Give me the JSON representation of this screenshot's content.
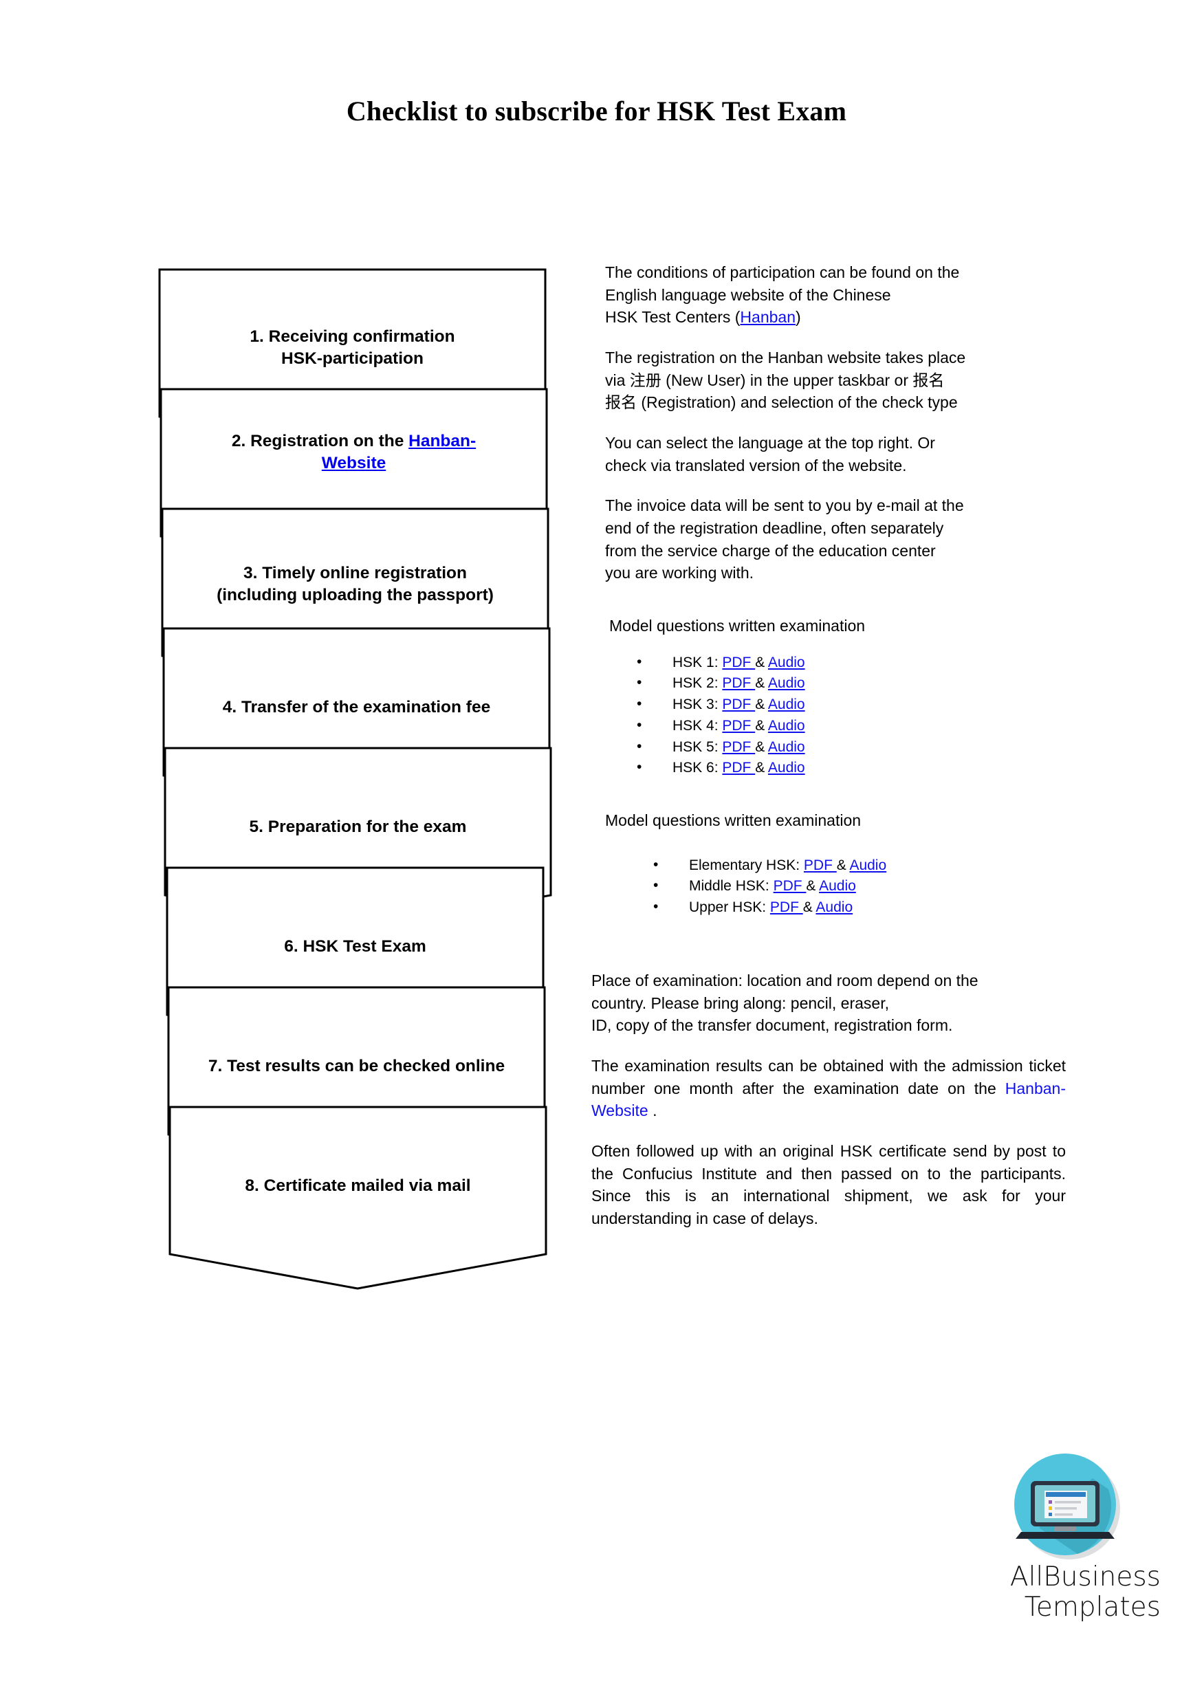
{
  "page": {
    "title": "Checklist to subscribe for HSK Test Exam"
  },
  "flowchart": {
    "steps": [
      {
        "id": 1,
        "text": "1. Receiving confirmation",
        "text2": "HSK-participation",
        "link": null
      },
      {
        "id": 2,
        "text": "2. Registration on the ",
        "link_text": "Hanban-",
        "link_text2": "Website",
        "text2": ""
      },
      {
        "id": 3,
        "text": "3. Timely online registration",
        "text2": "(including uploading the passport)",
        "link": null
      },
      {
        "id": 4,
        "text": "4. Transfer of the examination fee",
        "text2": "",
        "link": null
      },
      {
        "id": 5,
        "text": "5. Preparation for the exam",
        "text2": "",
        "link": null
      },
      {
        "id": 6,
        "text": "6. HSK Test Exam",
        "text2": "",
        "link": null
      },
      {
        "id": 7,
        "text": "7. Test results can be checked online",
        "text2": "",
        "link": null
      },
      {
        "id": 8,
        "text": "8. Certificate mailed via mail",
        "text2": "",
        "link": null
      }
    ]
  },
  "content": {
    "para1_a": "The conditions of participation can be found on the",
    "para1_b": "English language website of the Chinese",
    "para1_c": "HSK Test Centers  (",
    "para1_link": "Hanban",
    "para1_d": ")",
    "para2_a": "The registration on the Hanban website takes place",
    "para2_b": "via 注册 (New User) in the upper taskbar or 报名",
    "para2_c": "报名 (Registration) and selection of the check type",
    "para3_a": "You can select the language at the top right. Or",
    "para3_b": "check via translated version of the website.",
    "para4_a": "The invoice data will be sent to you by e-mail at the",
    "para4_b": "end of the registration deadline, often separately",
    "para4_c": "from the service charge of the education center",
    "para4_d": "you are working with.",
    "list1_heading": "Model questions written examination",
    "list1": [
      {
        "label": "HSK 1:",
        "pdf": "PDF ",
        "amp": "& ",
        "audio": "Audio"
      },
      {
        "label": "HSK 2:",
        "pdf": "PDF ",
        "amp": "& ",
        "audio": "Audio"
      },
      {
        "label": "HSK 3:",
        "pdf": "PDF ",
        "amp": "& ",
        "audio": "Audio"
      },
      {
        "label": "HSK 4:",
        "pdf": "PDF ",
        "amp": "& ",
        "audio": "Audio"
      },
      {
        "label": "HSK 5:",
        "pdf": "PDF ",
        "amp": "& ",
        "audio": "Audio"
      },
      {
        "label": "HSK 6:",
        "pdf": "PDF ",
        "amp": "& ",
        "audio": "Audio"
      }
    ],
    "list2_heading": "Model questions written examination",
    "list2": [
      {
        "label": "Elementary HSK:",
        "pdf": "PDF ",
        "amp": "& ",
        "audio": "Audio"
      },
      {
        "label": "Middle HSK:",
        "pdf": "PDF ",
        "amp": "& ",
        "audio": "Audio"
      },
      {
        "label": "Upper HSK:",
        "pdf": "PDF ",
        "amp": "& ",
        "audio": "Audio"
      }
    ],
    "para5_a": "Place of examination: location and room depend on the",
    "para5_b": "country. Please bring along: pencil, eraser,",
    "para5_c": "ID, copy of the transfer document, registration form.",
    "para6_pre": "The examination results can be obtained with the admission ticket number one month after the examination date on the ",
    "para6_link": "Hanban-Website ",
    "para6_post": ".",
    "para7": "Often followed up with an original HSK certificate send by post to the Confucius Institute and then passed on to the participants. Since this is an international shipment, we ask for your understanding in case of delays."
  },
  "logo": {
    "name_line1": "AllBusiness",
    "name_line2": "Templates",
    "circle_color": "#4FC4DC",
    "shadow_color": "#3BA9BF",
    "laptop_color": "#2C3442",
    "screen_color": "#79C8D2",
    "doc_color": "#F4F6F8",
    "doc_header_color": "#2E7FC4"
  }
}
